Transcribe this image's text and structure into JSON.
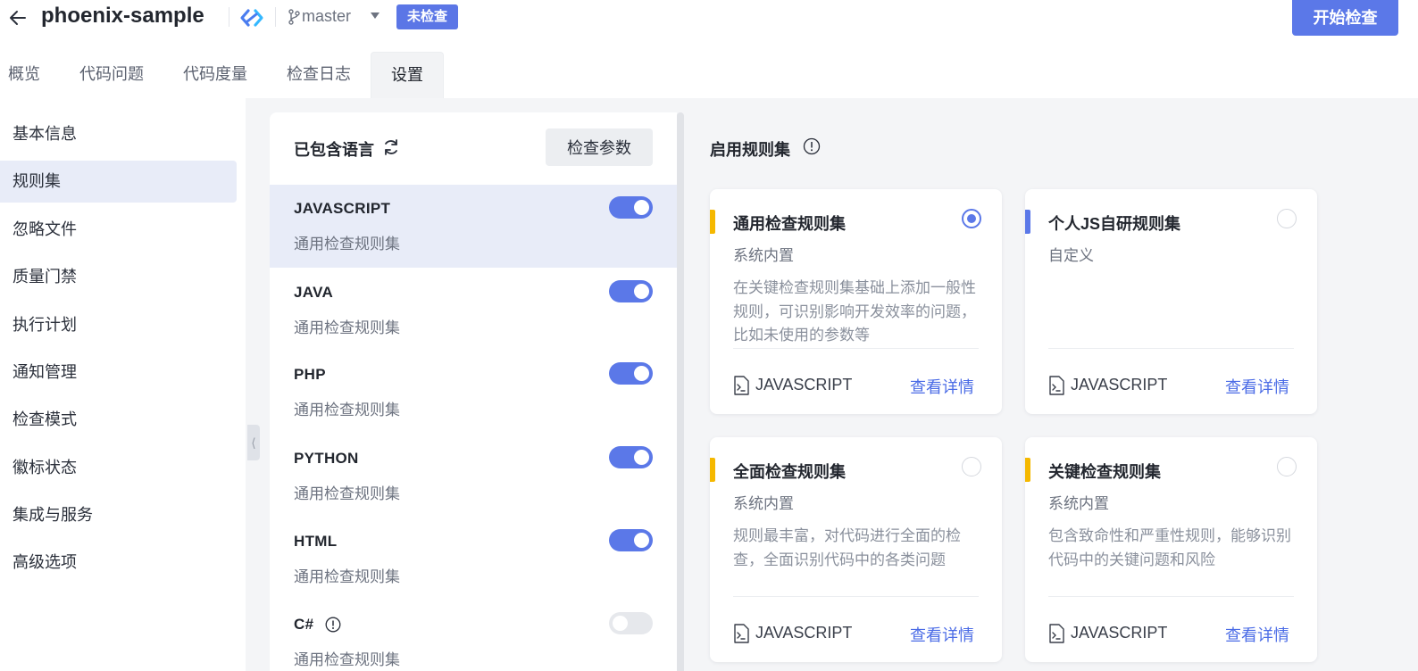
{
  "header": {
    "project_name": "phoenix-sample",
    "branch": "master",
    "status_badge": "未检查",
    "start_button": "开始检查"
  },
  "tabs": [
    {
      "label": "概览"
    },
    {
      "label": "代码问题"
    },
    {
      "label": "代码度量"
    },
    {
      "label": "检查日志"
    },
    {
      "label": "设置",
      "active": true
    }
  ],
  "sidebar": {
    "items": [
      {
        "label": "基本信息"
      },
      {
        "label": "规则集",
        "active": true
      },
      {
        "label": "忽略文件"
      },
      {
        "label": "质量门禁"
      },
      {
        "label": "执行计划"
      },
      {
        "label": "通知管理"
      },
      {
        "label": "检查模式"
      },
      {
        "label": "徽标状态"
      },
      {
        "label": "集成与服务"
      },
      {
        "label": "高级选项"
      }
    ]
  },
  "languages": {
    "title": "已包含语言",
    "params_button": "检查参数",
    "items": [
      {
        "name": "JAVASCRIPT",
        "ruleset": "通用检查规则集",
        "enabled": true,
        "active": true
      },
      {
        "name": "JAVA",
        "ruleset": "通用检查规则集",
        "enabled": true
      },
      {
        "name": "PHP",
        "ruleset": "通用检查规则集",
        "enabled": true
      },
      {
        "name": "PYTHON",
        "ruleset": "通用检查规则集",
        "enabled": true
      },
      {
        "name": "HTML",
        "ruleset": "通用检查规则集",
        "enabled": true
      },
      {
        "name": "C#",
        "ruleset": "通用检查规则集",
        "enabled": false,
        "info_icon": true
      }
    ]
  },
  "rules": {
    "title": "启用规则集",
    "cards": [
      {
        "title": "通用检查规则集",
        "type": "系统内置",
        "desc": "在关键检查规则集基础上添加一般性规则，可识别影响开发效率的问题，比如未使用的参数等",
        "lang": "JAVASCRIPT",
        "link": "查看详情",
        "selected": true,
        "bar_color": "#f5b800"
      },
      {
        "title": "个人JS自研规则集",
        "type": "自定义",
        "desc": "",
        "lang": "JAVASCRIPT",
        "link": "查看详情",
        "selected": false,
        "bar_color": "#5b78e8"
      },
      {
        "title": "全面检查规则集",
        "type": "系统内置",
        "desc": "规则最丰富，对代码进行全面的检查，全面识别代码中的各类问题",
        "lang": "JAVASCRIPT",
        "link": "查看详情",
        "selected": false,
        "bar_color": "#f5b800"
      },
      {
        "title": "关键检查规则集",
        "type": "系统内置",
        "desc": "包含致命性和严重性规则，能够识别代码中的关键问题和风险",
        "lang": "JAVASCRIPT",
        "link": "查看详情",
        "selected": false,
        "bar_color": "#f5b800"
      }
    ]
  },
  "colors": {
    "accent": "#5b78e8",
    "link": "#4a6be6",
    "warning_bar": "#f5b800"
  }
}
